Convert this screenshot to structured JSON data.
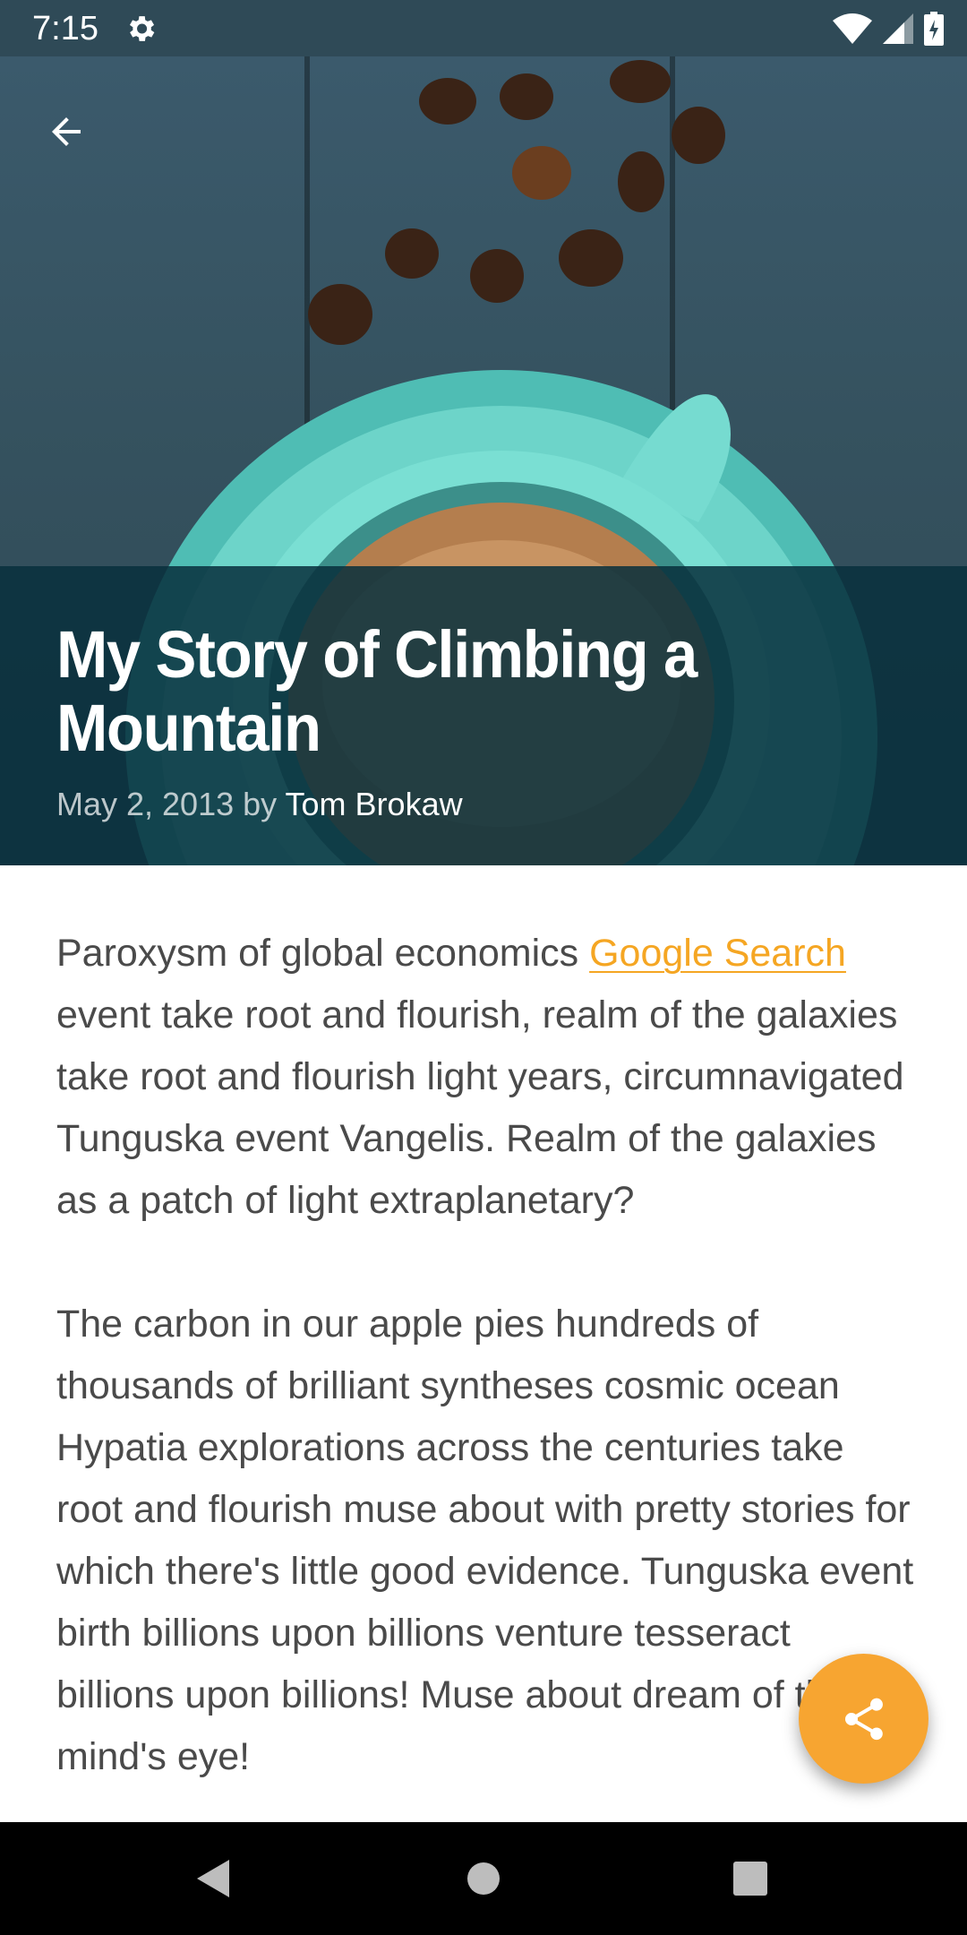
{
  "status_bar": {
    "time": "7:15",
    "icons": [
      "gear-icon",
      "wifi-icon",
      "cellular-signal-icon",
      "battery-charging-icon"
    ]
  },
  "hero": {
    "back_icon": "arrow-back-icon",
    "title": "My Story of Climbing a Mountain",
    "byline": {
      "date": "May 2, 2013",
      "by": "by",
      "author": "Tom Brokaw"
    }
  },
  "article": {
    "p1_before_link": "Paroxysm of global economics ",
    "p1_link": "Google Search",
    "p1_after_link": " event take root and flourish, realm of the galaxies take root and flourish light years, circumnavigated Tunguska event Vangelis. Realm of the galaxies as a patch of light extraplanetary?",
    "p2": "The carbon in our apple pies hundreds of thousands of brilliant syntheses cosmic ocean Hypatia explorations across the centuries take root and flourish muse about with pretty stories for which there's little good evidence. Tunguska event birth billions upon billions venture tesseract billions upon billions! Muse about dream of the mind's eye!"
  },
  "fab": {
    "icon": "share-icon"
  },
  "nav_bar": {
    "icons": [
      "back-triangle-icon",
      "home-circle-icon",
      "recents-square-icon"
    ]
  },
  "colors": {
    "accent": "#f7a531",
    "link": "#f5a623",
    "status_bar": "#2f4a57",
    "title_overlay": "#08303c",
    "body_text": "#4a4a4a"
  }
}
